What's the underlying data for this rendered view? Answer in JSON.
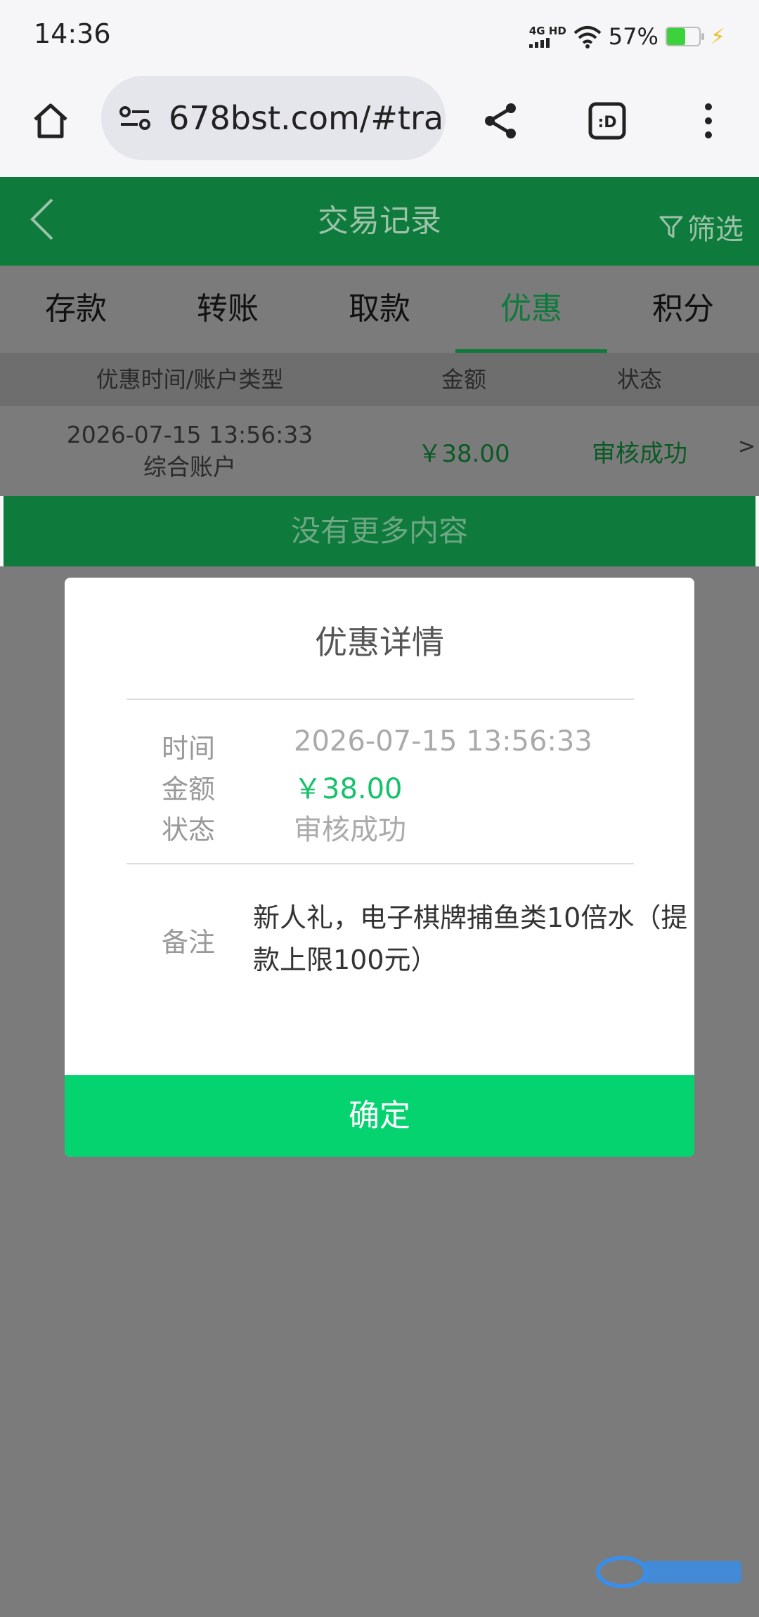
{
  "status_bar": {
    "time": "14:36",
    "network": "4G HD",
    "battery": "57%"
  },
  "browser": {
    "url": "678bst.com/#trar"
  },
  "header": {
    "title": "交易记录",
    "filter_label": "筛选"
  },
  "tabs": [
    {
      "label": "存款",
      "active": false
    },
    {
      "label": "转账",
      "active": false
    },
    {
      "label": "取款",
      "active": false
    },
    {
      "label": "优惠",
      "active": true
    },
    {
      "label": "积分",
      "active": false
    }
  ],
  "table": {
    "columns": [
      "优惠时间/账户类型",
      "金额",
      "状态"
    ],
    "rows": [
      {
        "datetime": "2026-07-15 13:56:33",
        "account_type": "综合账户",
        "amount": "￥38.00",
        "status": "审核成功",
        "arrow": ">"
      }
    ],
    "no_more": "没有更多内容"
  },
  "modal": {
    "title": "优惠详情",
    "time_label": "时间",
    "time_value": "2026-07-15 13:56:33",
    "amount_label": "金额",
    "amount_value": "￥38.00",
    "status_label": "状态",
    "status_value": "审核成功",
    "note_label": "备注",
    "note_value": "新人礼，电子棋牌捕鱼类10倍水（提款上限100元）",
    "confirm_label": "确定"
  },
  "colors": {
    "brand_green": "#0e7a3c",
    "confirm_green": "#05d36f",
    "amount_green": "#15c26a"
  }
}
